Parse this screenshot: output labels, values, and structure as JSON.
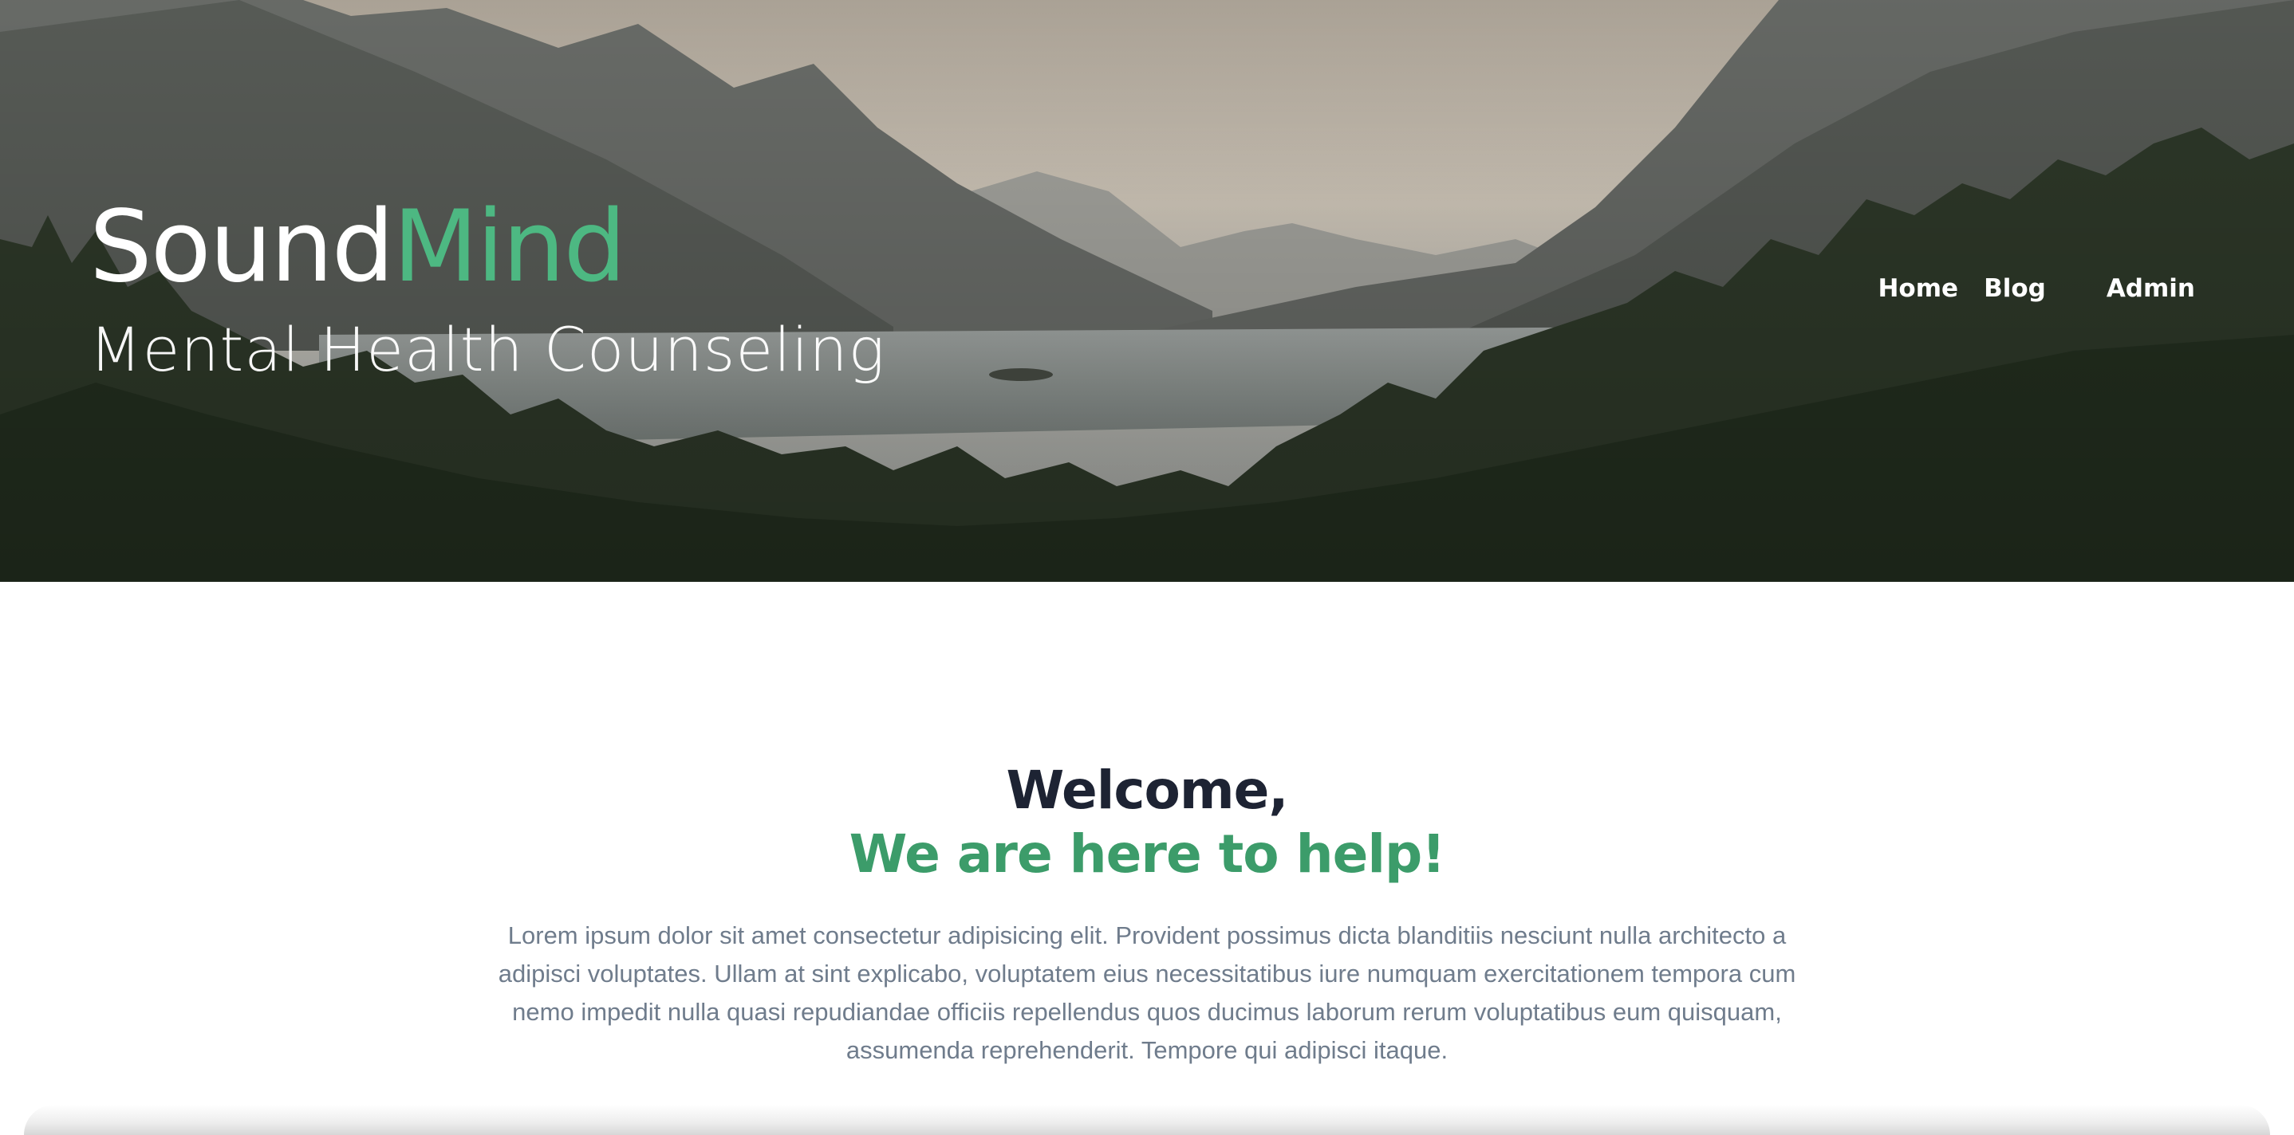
{
  "header": {
    "brand": {
      "name_part1": "Sound",
      "name_part2": "Mind",
      "tagline": "Mental Health Counseling"
    },
    "nav": [
      {
        "label": "Home"
      },
      {
        "label": "Blog"
      },
      {
        "label": "Admin"
      }
    ],
    "hero_image": "mountain-lake-forest-landscape"
  },
  "main": {
    "welcome": "Welcome,",
    "subheading": "We are here to help!",
    "intro": "Lorem ipsum dolor sit amet consectetur adipisicing elit. Provident possimus dicta blanditiis nesciunt nulla architecto a adipisci voluptates. Ullam at sint explicabo, voluptatem eius necessitatibus iure numquam exercitationem tempora cum nemo impedit nulla quasi repudiandae officiis repellendus quos ducimus laborum rerum voluptatibus eum quisquam, assumenda reprehenderit. Tempore qui adipisci itaque."
  },
  "colors": {
    "accent": "#4db882",
    "heading_dark": "#1d2333",
    "subheading_green": "#3c9c6a",
    "body_text": "#6f7c8c"
  }
}
